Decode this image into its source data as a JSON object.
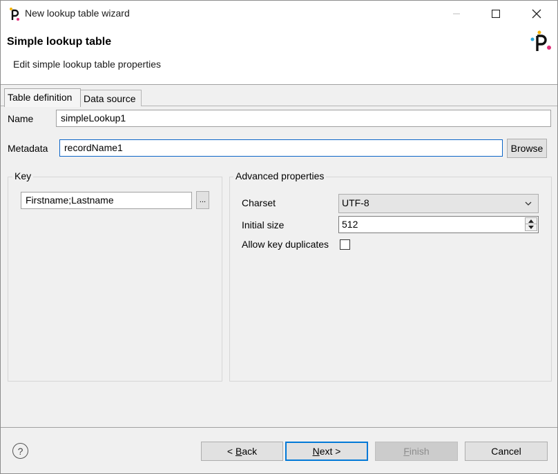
{
  "window": {
    "title": "New lookup table wizard",
    "minimize_icon": "minimize-icon",
    "maximize_icon": "maximize-icon",
    "close_icon": "close-icon"
  },
  "header": {
    "title": "Simple lookup table",
    "subtitle": "Edit simple lookup table properties",
    "logo_icon": "app-logo-icon"
  },
  "tabs": [
    {
      "label": "Table definition",
      "active": true
    },
    {
      "label": "Data source",
      "active": false
    }
  ],
  "form": {
    "name_label": "Name",
    "name_value": "simpleLookup1",
    "metadata_label": "Metadata",
    "metadata_value": "recordName1",
    "browse_label": "Browse"
  },
  "key_group": {
    "title": "Key",
    "value": "Firstname;Lastname",
    "ellipsis_label": "..."
  },
  "advanced": {
    "title": "Advanced properties",
    "charset_label": "Charset",
    "charset_value": "UTF-8",
    "initial_size_label": "Initial size",
    "initial_size_value": "512",
    "allow_dup_label": "Allow key duplicates",
    "allow_dup_checked": false
  },
  "footer": {
    "help_label": "?",
    "back_pre": "< ",
    "back_mnemonic": "B",
    "back_rest": "ack",
    "next_mnemonic": "N",
    "next_rest": "ext >",
    "finish_mnemonic": "F",
    "finish_rest": "inish",
    "cancel_label": "Cancel"
  },
  "colors": {
    "accent": "#0078d7",
    "logo_dot_pink": "#e0307a",
    "logo_dot_yellow": "#f5b400",
    "logo_dot_blue": "#2aa7d9"
  }
}
